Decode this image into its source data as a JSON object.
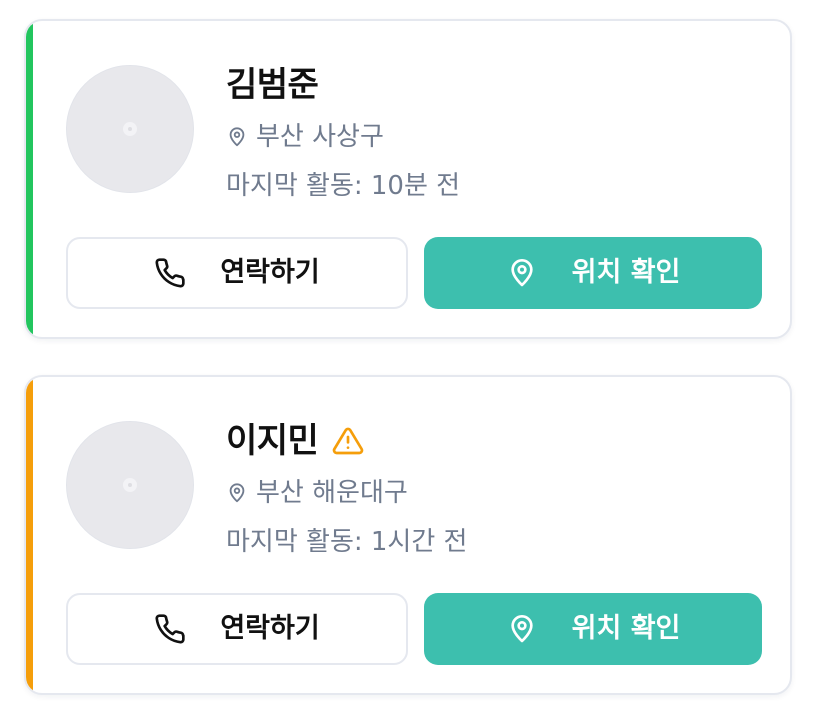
{
  "colors": {
    "status_online": "#22c55e",
    "status_warning": "#f59e0b",
    "primary": "#3dbfae",
    "text_primary": "#111111",
    "text_secondary": "#707b8e",
    "card_border": "#e5e8ef"
  },
  "cards": [
    {
      "name": "김범준",
      "warning": false,
      "location": "부산 사상구",
      "activity": "마지막 활동: 10분 전",
      "contact_label": "연락하기",
      "locate_label": "위치 확인",
      "icons": {
        "avatar": "user-avatar-placeholder",
        "location": "map-pin-icon",
        "contact": "phone-icon",
        "locate": "map-pin-icon"
      }
    },
    {
      "name": "이지민",
      "warning": true,
      "location": "부산 해운대구",
      "activity": "마지막 활동: 1시간 전",
      "contact_label": "연락하기",
      "locate_label": "위치 확인",
      "icons": {
        "avatar": "user-avatar-placeholder",
        "warning": "warning-triangle-icon",
        "location": "map-pin-icon",
        "contact": "phone-icon",
        "locate": "map-pin-icon"
      }
    }
  ]
}
